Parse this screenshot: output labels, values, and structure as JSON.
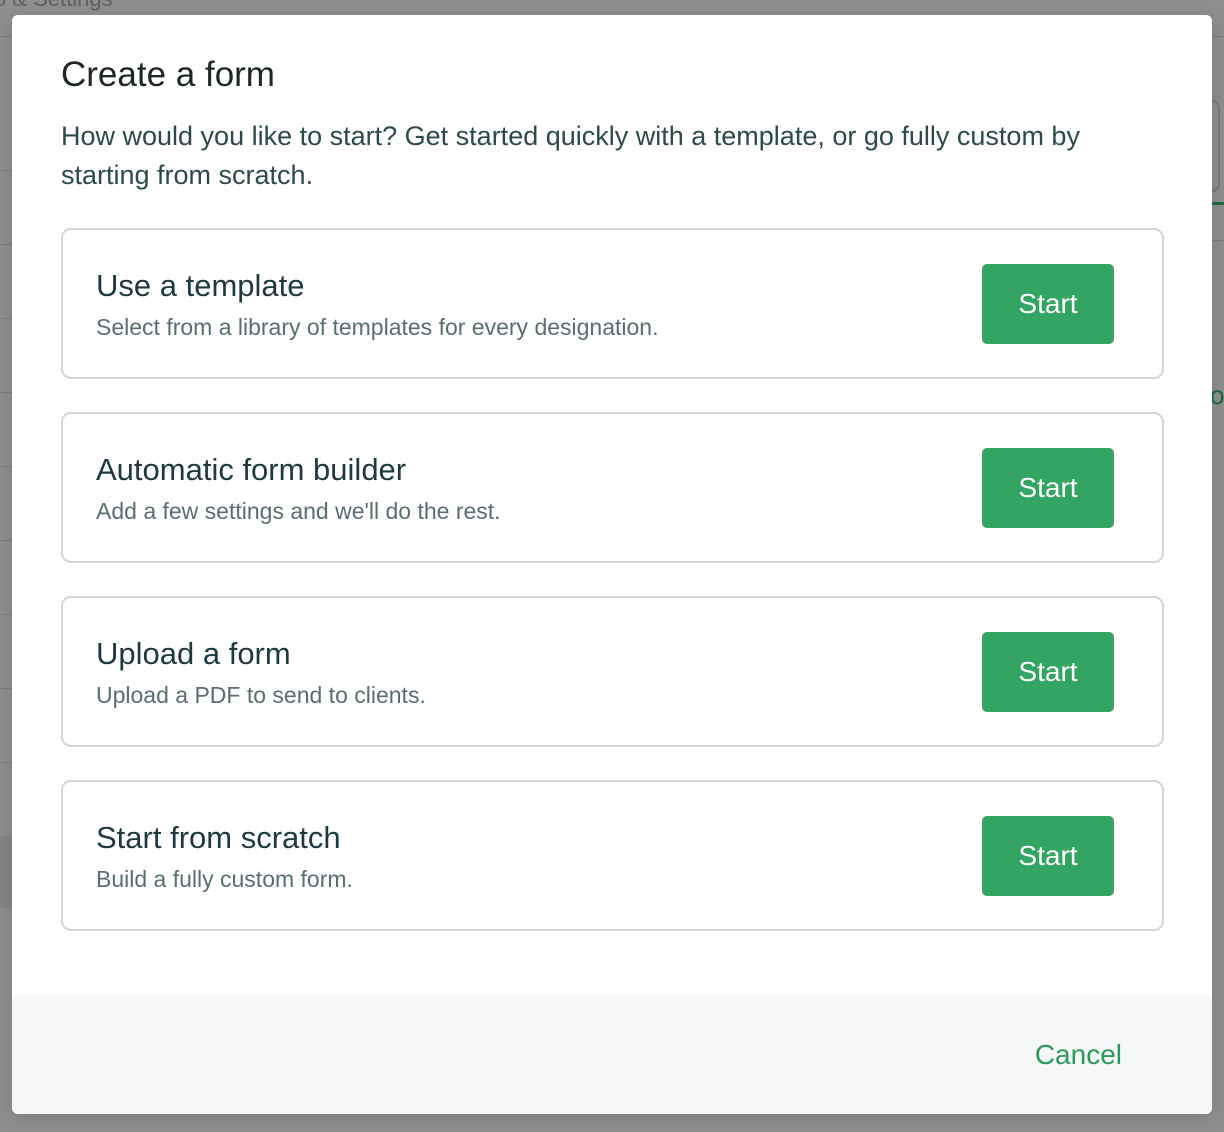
{
  "background": {
    "header_partial_text": "o & Settings",
    "overlay_color": "#8e9090"
  },
  "modal": {
    "title": "Create a form",
    "description": "How would you like to start? Get started quickly with a template, or go fully custom by starting from scratch.",
    "options": [
      {
        "title": "Use a template",
        "subtitle": "Select from a library of templates for every designation.",
        "button_label": "Start"
      },
      {
        "title": "Automatic form builder",
        "subtitle": "Add a few settings and we'll do the rest.",
        "button_label": "Start"
      },
      {
        "title": "Upload a form",
        "subtitle": "Upload a PDF to send to clients.",
        "button_label": "Start"
      },
      {
        "title": "Start from scratch",
        "subtitle": "Build a fully custom form.",
        "button_label": "Start"
      }
    ],
    "footer": {
      "cancel_label": "Cancel"
    }
  },
  "colors": {
    "accent": "#32a563",
    "accent_text": "#2b9a58",
    "title_text": "#1e3a40",
    "subtitle_text": "#5a6e72",
    "card_border": "#d2d6d6",
    "footer_bg": "#f6f8f7"
  }
}
